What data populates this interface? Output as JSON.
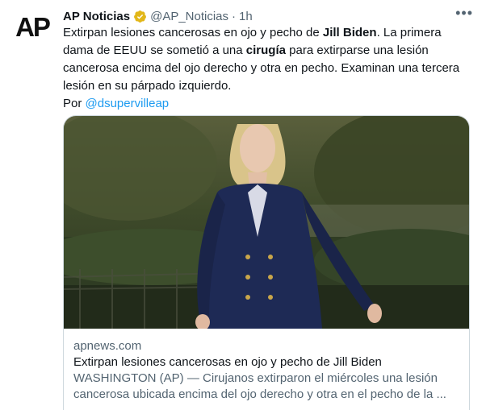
{
  "avatar": {
    "logo_text": "AP"
  },
  "tweet": {
    "author_name": "AP Noticias",
    "handle": "@AP_Noticias",
    "separator": "·",
    "time": "1h",
    "more_icon": "more-horizontal-icon",
    "verified_icon": "verified-badge-icon",
    "text": {
      "part1": "Extirpan lesiones cancerosas en ojo y pecho de ",
      "bold1": "Jill Biden",
      "part2": ". La primera dama de EEUU se sometió a una ",
      "bold2": "cirugía",
      "part3": " para extirparse una lesión cancerosa encima del ojo derecho y otra en pecho. Examinan una tercera lesión en su párpado izquierdo.",
      "credit_prefix": "Por ",
      "mention": "@dsupervilleap"
    }
  },
  "card": {
    "domain": "apnews.com",
    "title": "Extirpan lesiones cancerosas en ojo y pecho de Jill Biden",
    "description": "WASHINGTON (AP) — Cirujanos extirparon el miércoles una lesión cancerosa ubicada encima del ojo derecho y otra en el pecho de la ..."
  },
  "colors": {
    "link": "#1d9bf0",
    "secondary_text": "#536471",
    "primary_text": "#0f1419",
    "verified_badge": "#e2b719",
    "card_border": "#cfd9de"
  }
}
